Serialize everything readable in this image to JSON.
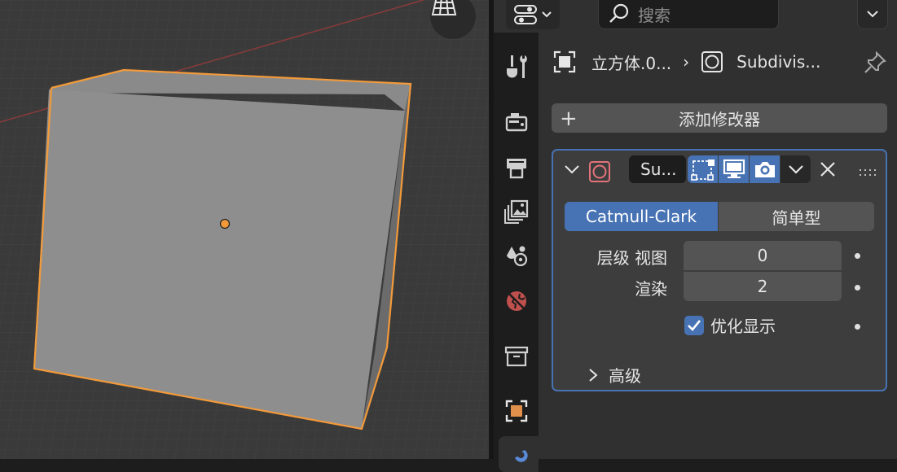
{
  "header": {
    "search_placeholder": "搜索",
    "editor_type_icon": "properties-editor-icon",
    "dropdown_icon": "chevron-down-icon"
  },
  "tabs": [
    {
      "name": "tool",
      "icon": "wrench-screwdriver-icon"
    },
    {
      "name": "render",
      "icon": "camera-back-icon"
    },
    {
      "name": "output",
      "icon": "printer-icon"
    },
    {
      "name": "view-layer",
      "icon": "image-stack-icon"
    },
    {
      "name": "scene",
      "icon": "scene-drops-icon"
    },
    {
      "name": "world",
      "icon": "world-icon"
    },
    {
      "name": "collection",
      "icon": "box-icon"
    },
    {
      "name": "object",
      "icon": "object-square-icon"
    },
    {
      "name": "modifiers",
      "icon": "wrench-icon",
      "active": true
    }
  ],
  "breadcrumb": {
    "object_name": "立方体.0...",
    "separator": "›",
    "modifier_name": "Subdivis..."
  },
  "add_modifier_label": "添加修改器",
  "modifier": {
    "name": "Su...",
    "subdivision_types": [
      "Catmull-Clark",
      "简单型"
    ],
    "selected_type": "Catmull-Clark",
    "levels_viewport_label": "层级 视图",
    "levels_viewport_value": "0",
    "render_label": "渲染",
    "render_value": "2",
    "optimal_display_label": "优化显示",
    "optimal_display_checked": true,
    "advanced_label": "高级"
  },
  "colors": {
    "accent": "#4772b3",
    "selection_outline": "#f29a3a",
    "origin_dot": "#f29a3a",
    "modifier_icon": "#e2737a"
  }
}
